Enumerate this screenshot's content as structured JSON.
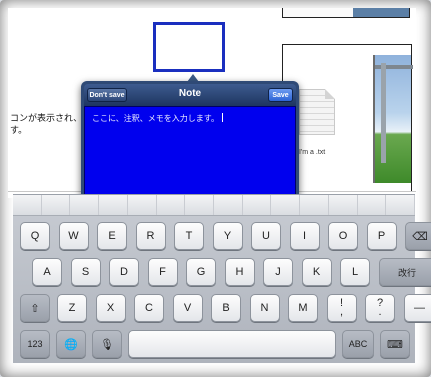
{
  "document": {
    "body_text": "コンが表示され、\nす。",
    "file_name": "I'm a .txt"
  },
  "note_popover": {
    "title": "Note",
    "dont_save_label": "Don't save",
    "save_label": "Save",
    "placeholder": "ここに、注釈、メモを入力します。",
    "area_color": "#0000ee"
  },
  "keyboard": {
    "row1": [
      "Q",
      "W",
      "E",
      "R",
      "T",
      "Y",
      "U",
      "I",
      "O",
      "P"
    ],
    "row2": [
      "A",
      "S",
      "D",
      "F",
      "G",
      "H",
      "J",
      "K",
      "L"
    ],
    "row3": [
      "Z",
      "X",
      "C",
      "V",
      "B",
      "N",
      "M"
    ],
    "return_label": "改行",
    "abc_label": "ABC",
    "num_label": "123",
    "punct": [
      {
        "top": "!",
        "bottom": ","
      },
      {
        "top": "?",
        "bottom": "."
      }
    ],
    "dash_label": "—"
  },
  "icons": {
    "backspace": "backspace-icon",
    "shift": "shift-icon",
    "globe": "globe-icon",
    "mic": "microphone-icon",
    "hide": "keyboard-hide-icon"
  },
  "colors": {
    "accent": "#2d64d6",
    "frame_bar": "#2f4a76",
    "shape_stroke": "#1a2fbf"
  }
}
